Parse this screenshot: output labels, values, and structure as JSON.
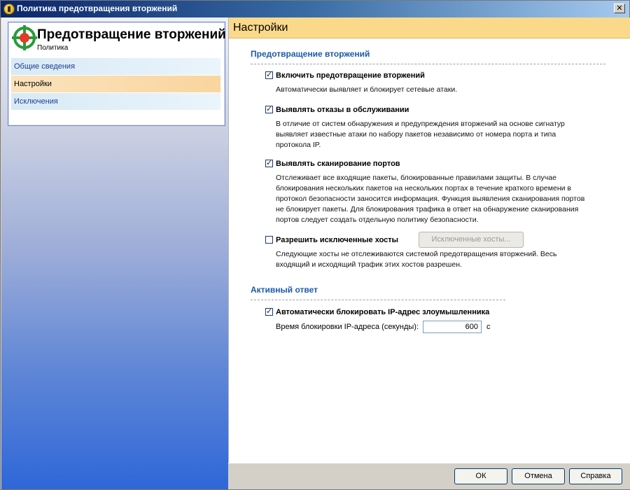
{
  "window": {
    "title": "Политика предотвращения вторжений",
    "close_glyph": "✕"
  },
  "nav": {
    "heading": "Предотвращение вторжений",
    "subheading": "Политика",
    "items": [
      {
        "label": "Общие сведения"
      },
      {
        "label": "Настройки"
      },
      {
        "label": "Исключения"
      }
    ],
    "selected": "Настройки"
  },
  "panel": {
    "title": "Настройки"
  },
  "section_prevention": {
    "title": "Предотвращение вторжений",
    "options": [
      {
        "label": "Включить предотвращение вторжений",
        "checked": true,
        "description": "Автоматически выявляет и блокирует сетевые атаки."
      },
      {
        "label": "Выявлять отказы в обслуживании",
        "checked": true,
        "description": "В отличие от систем обнаружения и предупреждения вторжений на основе сигнатур выявляет известные атаки по набору пакетов независимо от номера порта и типа протокола IP."
      },
      {
        "label": "Выявлять сканирование портов",
        "checked": true,
        "description": "Отслеживает все входящие пакеты, блокированные правилами защиты.  В случае блокирования нескольких пакетов на нескольких портах в течение краткого времени в протокол безопасности заносится информация. Функция выявления сканирования портов не блокирует пакеты. Для блокирования трафика в ответ на обнаружение сканирования портов следует создать отдельную политику безопасности."
      },
      {
        "label": "Разрешить исключенные хосты",
        "checked": false,
        "description": "Следующие хосты не отслеживаются системой предотвращения вторжений. Весь входящий и исходящий трафик этих хостов разрешен."
      }
    ],
    "excluded_hosts_button": "Исключенные хосты..."
  },
  "section_active": {
    "title": "Активный ответ",
    "option": {
      "label": "Автоматически блокировать IP-адрес злоумышленника",
      "checked": true
    },
    "block_time_label": "Время блокировки IP-адреса (секунды):",
    "block_time_value": "600",
    "unit": "с"
  },
  "footer": {
    "ok": "ОК",
    "cancel": "Отмена",
    "help": "Справка"
  },
  "colors": {
    "accent_header": "#fbd98a",
    "section_title": "#1c5aa8",
    "nav_selected": "#f9d59f"
  },
  "icons": {
    "app": "shield-app-icon",
    "policy": "crosshair-target-icon"
  }
}
